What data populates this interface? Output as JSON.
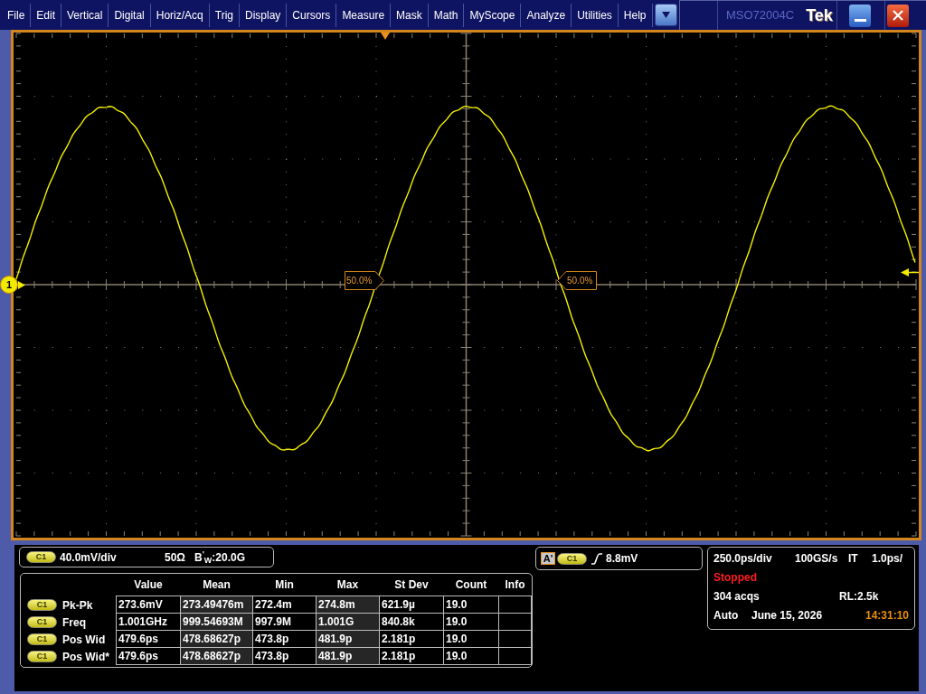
{
  "menu_bar": {
    "items": [
      "File",
      "Edit",
      "Vertical",
      "Digital",
      "Horiz/Acq",
      "Trig",
      "Display",
      "Cursors",
      "Measure",
      "Mask",
      "Math",
      "MyScope",
      "Analyze",
      "Utilities",
      "Help"
    ],
    "model": "MSO72004C",
    "logo": "Tek"
  },
  "display": {
    "channel_marker": "1",
    "reference_labels": [
      {
        "text": "50.0%",
        "kind": "right"
      },
      {
        "text": "50.0%",
        "kind": "left"
      }
    ]
  },
  "vertical": {
    "source": "C1",
    "scale": "40.0mV/div",
    "termination": "50Ω",
    "bandwidth": "B$^{'}$$_{W}$:20.0G"
  },
  "trigger": {
    "event": "A'",
    "source": "C1",
    "rising": true,
    "threshold": "8.8mV"
  },
  "measurements": {
    "columns": [
      "Value",
      "Mean",
      "Min",
      "Max",
      "St Dev",
      "Count",
      "Info"
    ],
    "rows": [
      {
        "source": "C1",
        "name": "Pk-Pk",
        "cells": [
          "273.6mV",
          "273.49476m",
          "272.4m",
          "274.8m",
          "621.9µ",
          "19.0"
        ]
      },
      {
        "source": "C1",
        "name": "Freq",
        "cells": [
          "1.001GHz",
          "999.54693M",
          "997.9M",
          "1.001G",
          "840.8k",
          "19.0"
        ]
      },
      {
        "source": "C1",
        "name": "Pos Wid",
        "cells": [
          "479.6ps",
          "478.68627p",
          "473.8p",
          "481.9p",
          "2.181p",
          "19.0"
        ]
      },
      {
        "source": "C1",
        "name": "Pos Wid*",
        "cells": [
          "479.6ps",
          "478.68627p",
          "473.8p",
          "481.9p",
          "2.181p",
          "19.0"
        ]
      }
    ]
  },
  "horizontal": {
    "scale": "250.0ps/div",
    "sample_rate": "100GS/s",
    "mode": "IT",
    "resolution": "1.0ps/",
    "state": "Stopped",
    "acquisitions": "304 acqs",
    "record_length": "RL:2.5k",
    "trigger_mode": "Auto",
    "date": "June 15, 2026",
    "time": "14:31:10"
  }
}
